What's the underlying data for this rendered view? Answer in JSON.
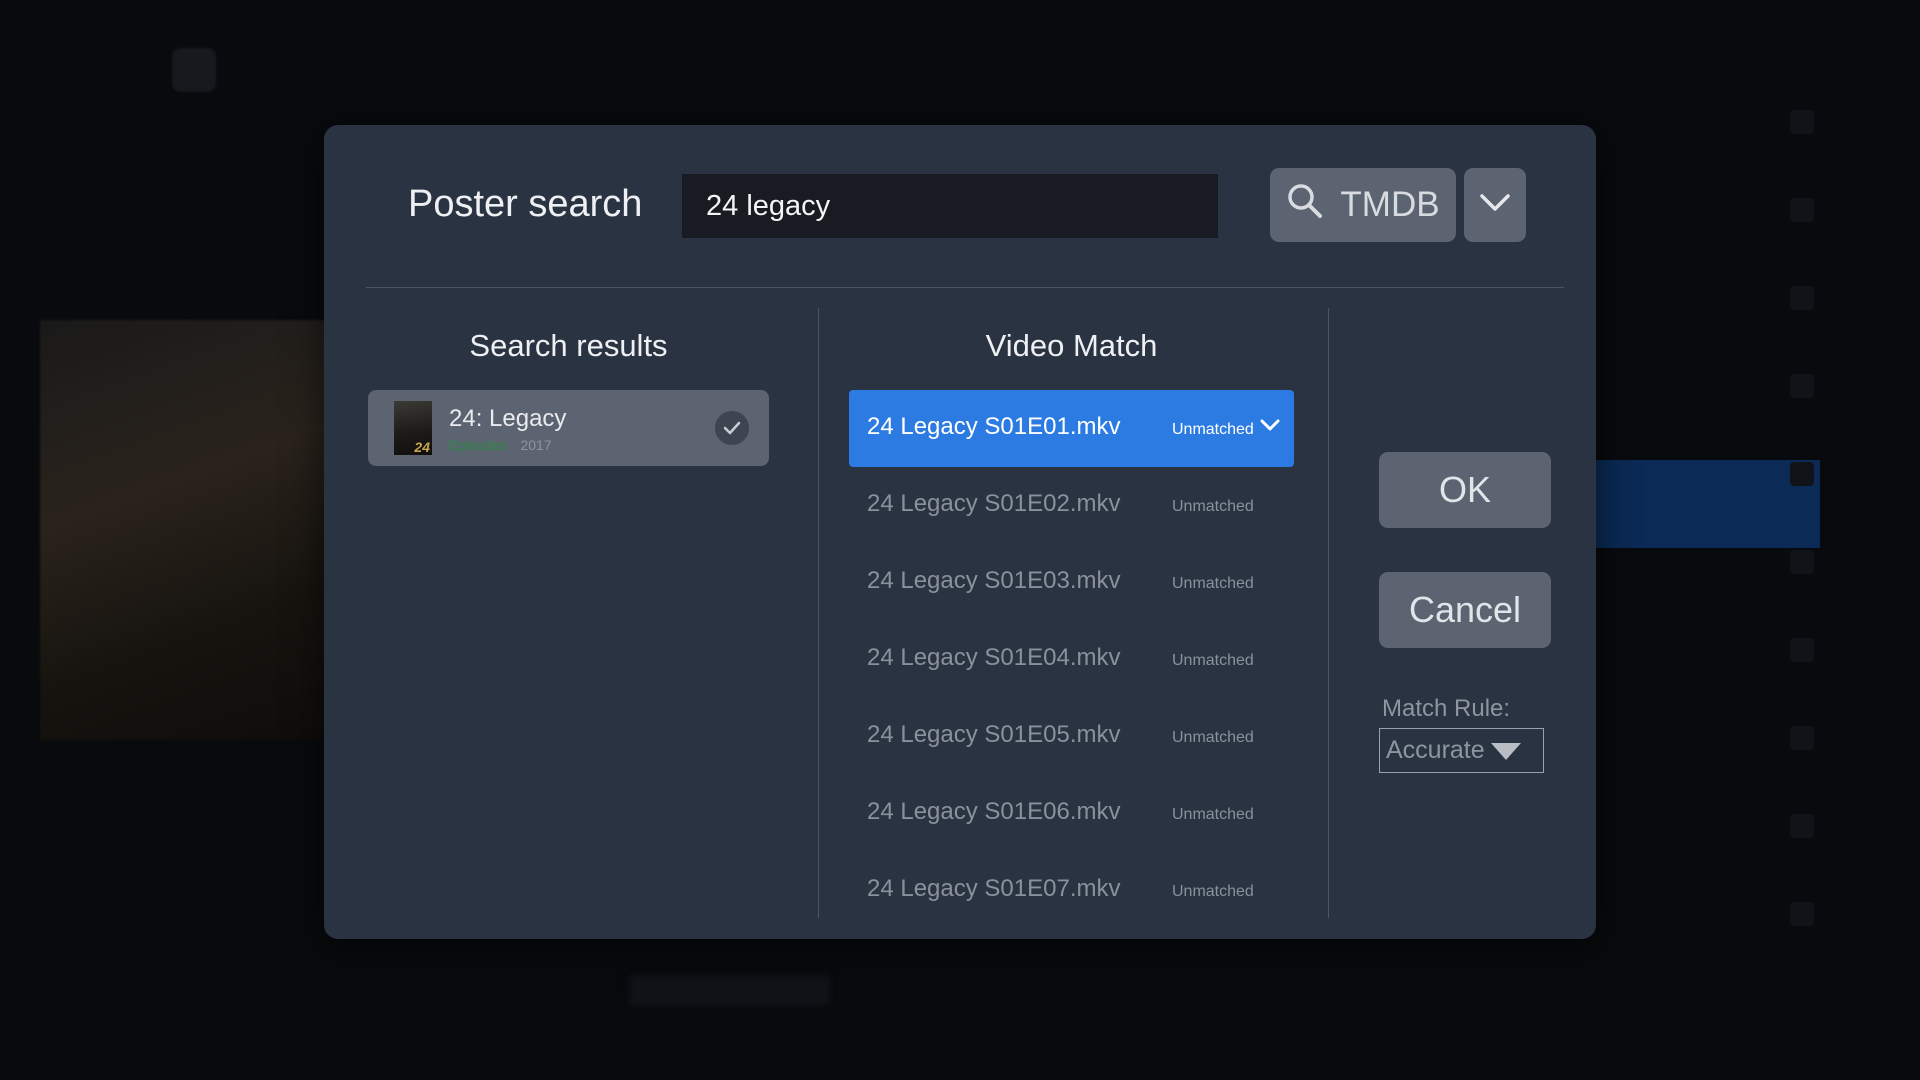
{
  "dialog": {
    "title": "Poster search",
    "search_value": "24 legacy",
    "provider_label": "TMDB",
    "icons": {
      "search": "search-icon",
      "dropdown": "chevron-down-icon"
    }
  },
  "search_results": {
    "title": "Search results",
    "items": [
      {
        "title": "24: Legacy",
        "type": "Episodes",
        "year": "2017",
        "selected": true
      }
    ]
  },
  "video_match": {
    "title": "Video Match",
    "items": [
      {
        "name": "24 Legacy S01E01.mkv",
        "status": "Unmatched",
        "selected": true
      },
      {
        "name": "24 Legacy S01E02.mkv",
        "status": "Unmatched",
        "selected": false
      },
      {
        "name": "24 Legacy S01E03.mkv",
        "status": "Unmatched",
        "selected": false
      },
      {
        "name": "24 Legacy S01E04.mkv",
        "status": "Unmatched",
        "selected": false
      },
      {
        "name": "24 Legacy S01E05.mkv",
        "status": "Unmatched",
        "selected": false
      },
      {
        "name": "24 Legacy S01E06.mkv",
        "status": "Unmatched",
        "selected": false
      },
      {
        "name": "24 Legacy S01E07.mkv",
        "status": "Unmatched",
        "selected": false
      }
    ]
  },
  "actions": {
    "ok_label": "OK",
    "cancel_label": "Cancel",
    "match_rule_label": "Match Rule:",
    "match_rule_value": "Accurate"
  },
  "colors": {
    "dialog_bg": "#293341",
    "accent": "#2c7be2",
    "button_bg": "#5b6470",
    "episode_type": "#2d8a46"
  }
}
